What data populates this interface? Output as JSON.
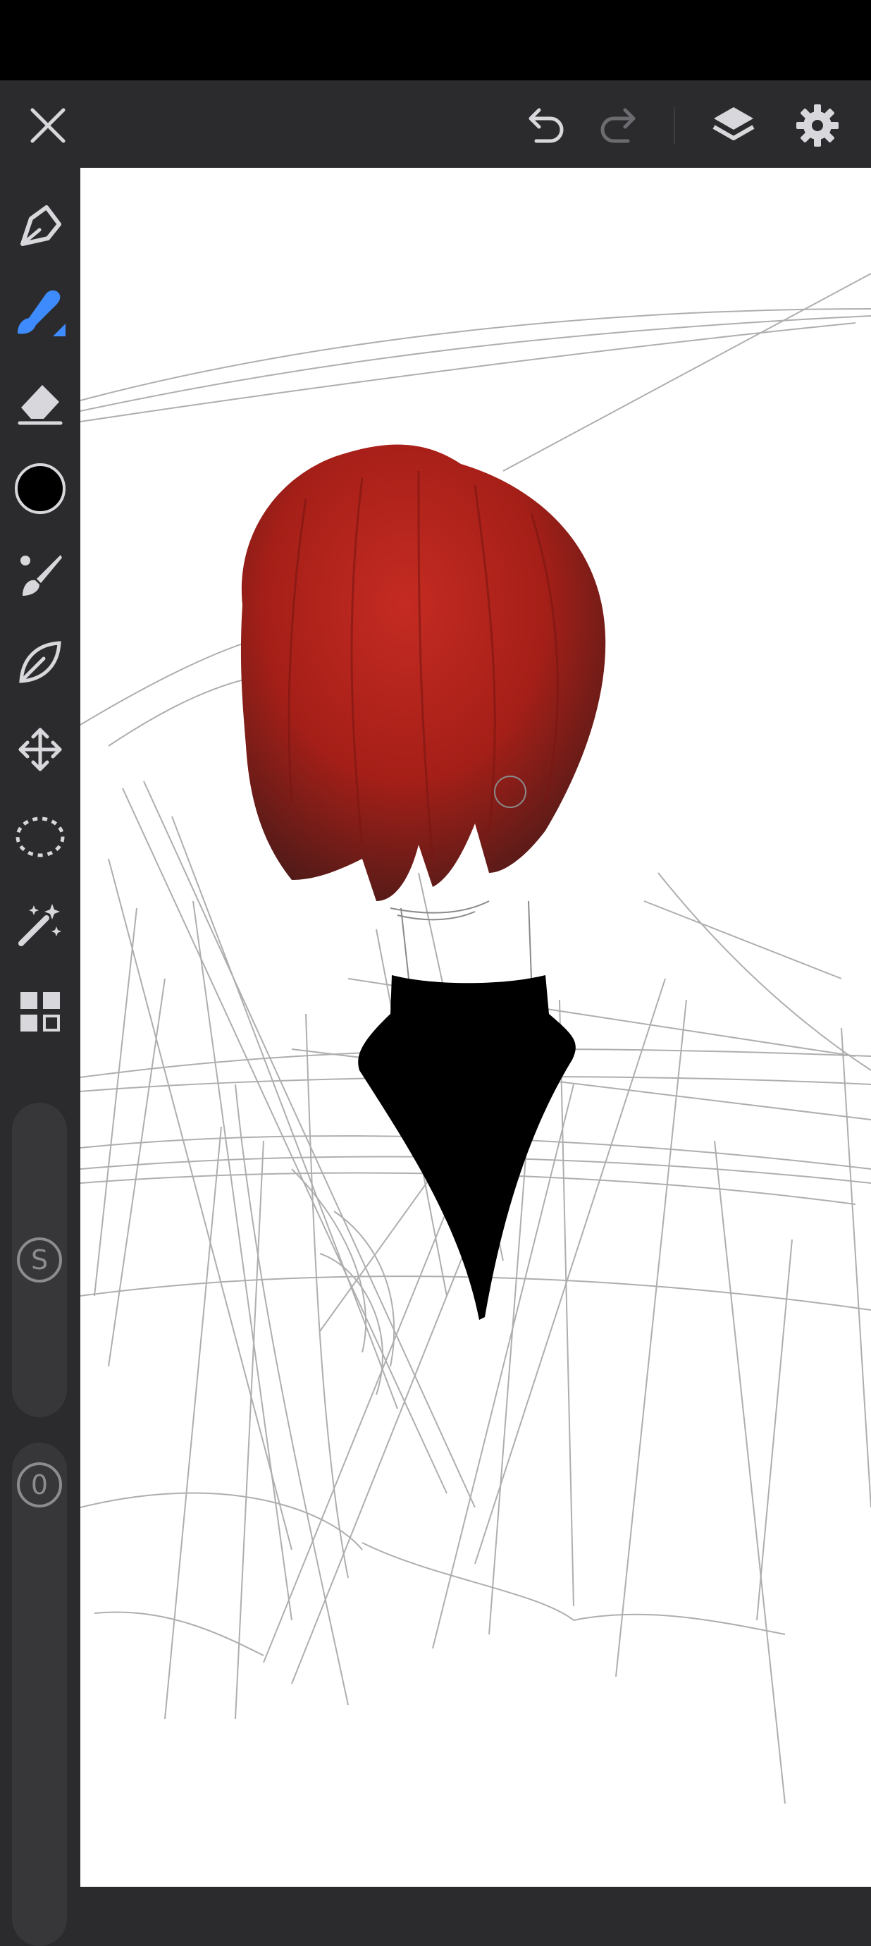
{
  "app": {
    "accent_color": "#3d8bfd",
    "icon_color": "#d8d8dc"
  },
  "toolbar": {
    "close_icon": "close-icon",
    "undo_icon": "undo-icon",
    "redo_icon": "redo-icon",
    "layers_icon": "layers-icon",
    "settings_icon": "gear-icon",
    "redo_enabled": false
  },
  "tools": [
    {
      "name": "pen-tool",
      "icon": "pen-icon",
      "active": false
    },
    {
      "name": "brush-tool",
      "icon": "brush-icon",
      "active": true
    },
    {
      "name": "eraser-tool",
      "icon": "eraser-icon",
      "active": false
    },
    {
      "name": "color-picker",
      "icon": "color-swatch",
      "color": "#000000",
      "active": false
    },
    {
      "name": "paint-brush-tool",
      "icon": "paintbrush-icon",
      "active": false
    },
    {
      "name": "smudge-tool",
      "icon": "leaf-icon",
      "active": false
    },
    {
      "name": "transform-tool",
      "icon": "move-arrows-icon",
      "active": false
    },
    {
      "name": "lasso-select-tool",
      "icon": "lasso-icon",
      "active": false
    },
    {
      "name": "magic-wand-tool",
      "icon": "magic-wand-icon",
      "active": false
    },
    {
      "name": "more-tools",
      "icon": "grid-icon",
      "active": false
    }
  ],
  "sliders": {
    "size_label": "S",
    "opacity_label": "0"
  },
  "artwork": {
    "hair_color": "#b3231c",
    "turtleneck_color": "#000000",
    "sketch_color": "#9a9a9a"
  }
}
